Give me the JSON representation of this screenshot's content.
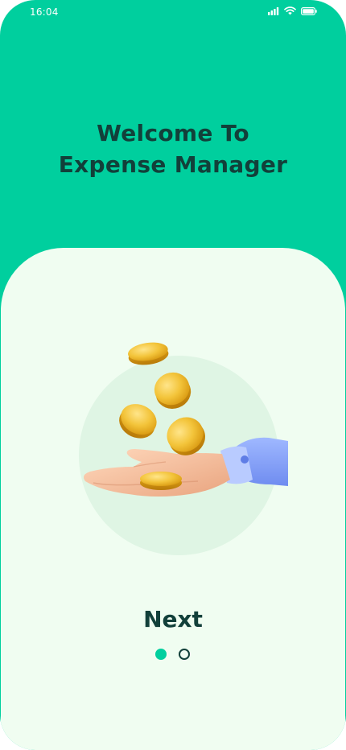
{
  "status_bar": {
    "time": "16:04",
    "icons": [
      "signal-icon",
      "wifi-icon",
      "battery-icon"
    ]
  },
  "onboarding": {
    "title_line1": "Welcome To",
    "title_line2": "Expense Manager",
    "next_label": "Next",
    "page_count": 2,
    "current_page": 1
  },
  "colors": {
    "accent": "#00cf9e",
    "card_background": "#f0fdf1",
    "title_text": "#12403a"
  }
}
